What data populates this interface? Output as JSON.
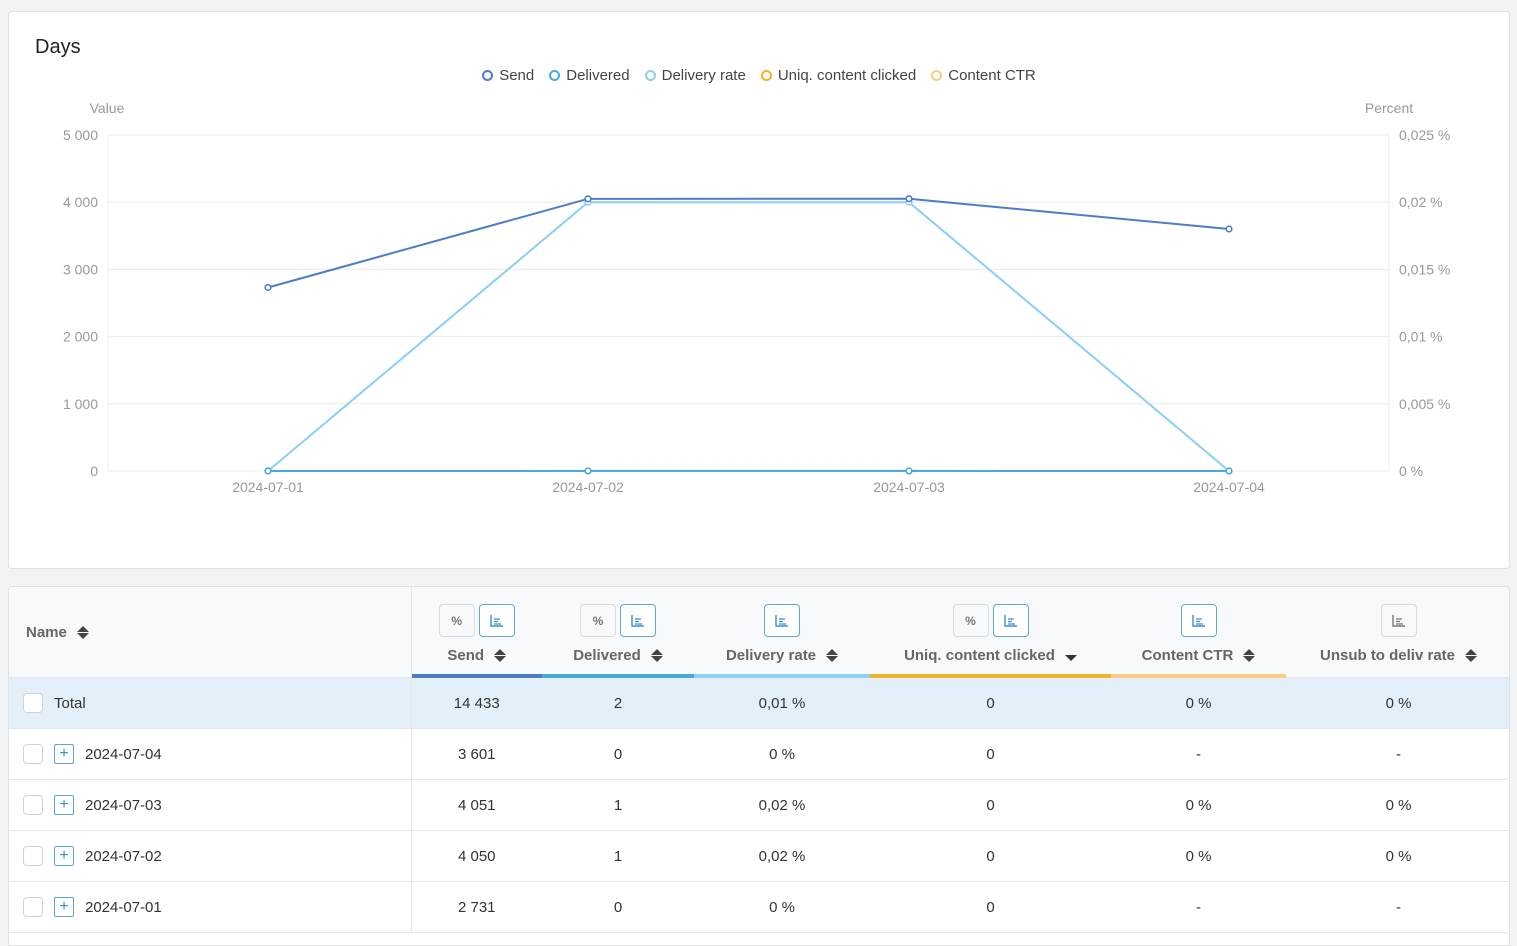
{
  "chart_card": {
    "title": "Days"
  },
  "chart_data": {
    "type": "line",
    "title": "Days",
    "x": [
      "2024-07-01",
      "2024-07-02",
      "2024-07-03",
      "2024-07-04"
    ],
    "y_left": {
      "label": "Value",
      "range": [
        0,
        5000
      ],
      "ticks": [
        0,
        1000,
        2000,
        3000,
        4000,
        5000
      ],
      "tick_labels": [
        "0",
        "1 000",
        "2 000",
        "3 000",
        "4 000",
        "5 000"
      ]
    },
    "y_right": {
      "label": "Percent",
      "range": [
        0,
        0.025
      ],
      "ticks": [
        0,
        0.005,
        0.01,
        0.015,
        0.02,
        0.025
      ],
      "tick_labels": [
        "0 %",
        "0,005 %",
        "0,01 %",
        "0,015 %",
        "0,02 %",
        "0,025 %"
      ]
    },
    "grid": true,
    "legend_position": "top-center",
    "series": [
      {
        "name": "Send",
        "axis": "left",
        "color": "#4f7cc9",
        "values": [
          2731,
          4050,
          4051,
          3601
        ]
      },
      {
        "name": "Delivered",
        "axis": "left",
        "color": "#4aa8e0",
        "values": [
          0,
          1,
          1,
          0
        ]
      },
      {
        "name": "Delivery rate",
        "axis": "right",
        "color": "#8ccff0",
        "values": [
          0,
          0.02,
          0.02,
          0
        ]
      },
      {
        "name": "Uniq. content clicked",
        "axis": "left",
        "color": "#f0b429",
        "values": [
          0,
          0,
          0,
          0
        ]
      },
      {
        "name": "Content CTR",
        "axis": "right",
        "color": "#f9cc86",
        "values": [
          0,
          0,
          0,
          0
        ]
      }
    ]
  },
  "table": {
    "columns": [
      {
        "key": "name",
        "label": "Name",
        "sort": "both",
        "buttons": []
      },
      {
        "key": "send",
        "label": "Send",
        "sort": "both",
        "buttons": [
          "percent",
          "chart-active"
        ],
        "bar_color": "#4f7cc9"
      },
      {
        "key": "delivered",
        "label": "Delivered",
        "sort": "both",
        "buttons": [
          "percent",
          "chart-active"
        ],
        "bar_color": "#4aa8e0"
      },
      {
        "key": "delivery_rate",
        "label": "Delivery rate",
        "sort": "both",
        "buttons": [
          "chart-active"
        ],
        "bar_color": "#8ccff0"
      },
      {
        "key": "uniq_clicked",
        "label": "Uniq. content clicked",
        "sort": "desc",
        "buttons": [
          "percent",
          "chart-active"
        ],
        "bar_color": "#f0b429"
      },
      {
        "key": "content_ctr",
        "label": "Content CTR",
        "sort": "both",
        "buttons": [
          "chart-active"
        ],
        "bar_color": "#f9cc86"
      },
      {
        "key": "unsub_rate",
        "label": "Unsub to deliv rate",
        "sort": "both",
        "buttons": [
          "chart"
        ],
        "bar_color": ""
      }
    ],
    "button_icons": {
      "percent": "%",
      "chart": "bar-chart-icon"
    },
    "rows": [
      {
        "name": "Total",
        "total": true,
        "send": "14 433",
        "delivered": "2",
        "delivery_rate": "0,01 %",
        "uniq_clicked": "0",
        "content_ctr": "0 %",
        "unsub_rate": "0 %"
      },
      {
        "name": "2024-07-04",
        "total": false,
        "send": "3 601",
        "delivered": "0",
        "delivery_rate": "0 %",
        "uniq_clicked": "0",
        "content_ctr": "-",
        "unsub_rate": "-"
      },
      {
        "name": "2024-07-03",
        "total": false,
        "send": "4 051",
        "delivered": "1",
        "delivery_rate": "0,02 %",
        "uniq_clicked": "0",
        "content_ctr": "0 %",
        "unsub_rate": "0 %"
      },
      {
        "name": "2024-07-02",
        "total": false,
        "send": "4 050",
        "delivered": "1",
        "delivery_rate": "0,02 %",
        "uniq_clicked": "0",
        "content_ctr": "0 %",
        "unsub_rate": "0 %"
      },
      {
        "name": "2024-07-01",
        "total": false,
        "send": "2 731",
        "delivered": "0",
        "delivery_rate": "0 %",
        "uniq_clicked": "0",
        "content_ctr": "-",
        "unsub_rate": "-"
      }
    ],
    "expand_symbol": "+"
  }
}
